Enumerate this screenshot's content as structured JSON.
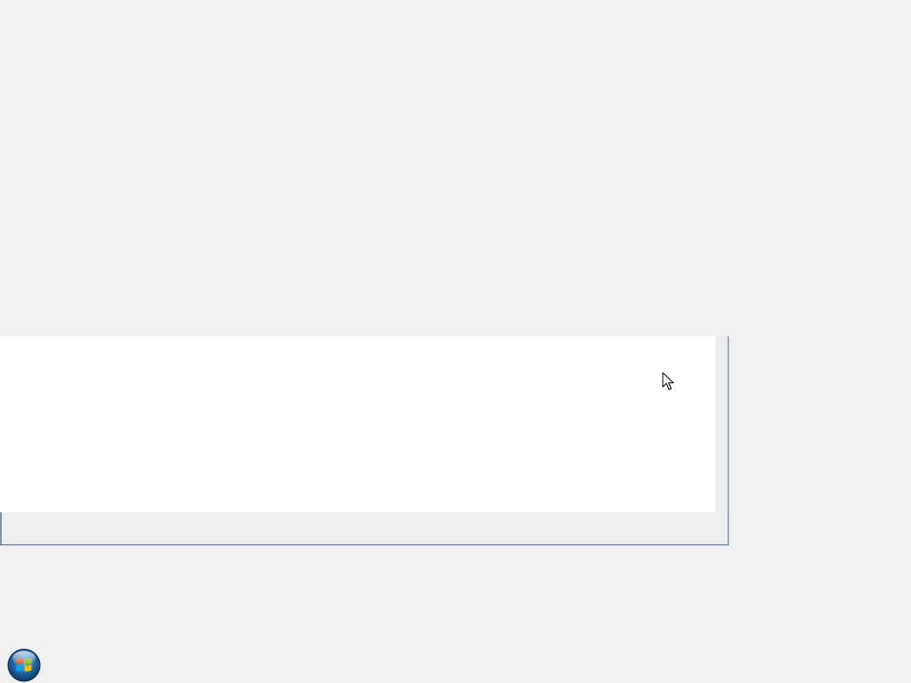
{
  "desktop": {
    "background_color": "#f0f0f0"
  },
  "window": {
    "client_background": "#ffffff",
    "frame_color": "#7f8fa8",
    "status_text": ""
  },
  "cursor": {
    "icon": "arrow-cursor-icon"
  },
  "taskbar": {
    "start_button_icon": "windows-start-orb-icon",
    "start_button_label": ""
  }
}
